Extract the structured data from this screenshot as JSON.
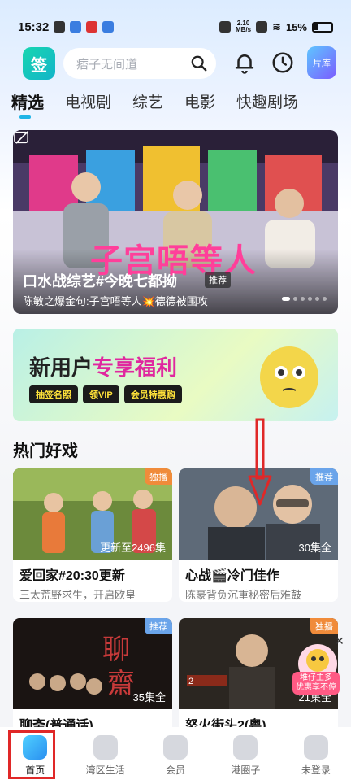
{
  "status": {
    "time": "15:32",
    "speed_value": "2.10",
    "speed_unit": "MB/s",
    "battery": "15%"
  },
  "header": {
    "search_placeholder": "痞子无间道",
    "library_label": "片库"
  },
  "tabs": [
    {
      "label": "精选"
    },
    {
      "label": "电视剧"
    },
    {
      "label": "综艺"
    },
    {
      "label": "电影"
    },
    {
      "label": "快趣剧场"
    }
  ],
  "banner": {
    "title": "口水战综艺#今晚七都拗",
    "badge": "推荐",
    "subtitle": "陈敏之爆金句:子宫唔等人💥德德被围攻",
    "overlay_text": "子宫唔等人"
  },
  "promo": {
    "title_part1": "新用户",
    "title_part2": "专享福利",
    "pills": [
      "抽签名照",
      "领VIP",
      "会员特惠购"
    ]
  },
  "section": {
    "title": "热门好戏"
  },
  "cards": [
    {
      "title": "爱回家#20:30更新",
      "subtitle": "三太荒野求生，开启欧皇",
      "tag": "独播",
      "episodes": "更新至2496集"
    },
    {
      "title": "心战🎬冷门佳作",
      "subtitle": "陈豪背负沉重秘密后难鼓",
      "tag": "推荐",
      "episodes": "30集全"
    },
    {
      "title": "聊斋(普通话)",
      "subtitle": "",
      "tag": "推荐",
      "episodes": "35集全"
    },
    {
      "title": "怒火街头2(粤)",
      "subtitle": "",
      "tag": "独播",
      "episodes": "21集全"
    }
  ],
  "float_ad": {
    "label_line1": "堆仔主多",
    "label_line2": "优惠享不停"
  },
  "nav": [
    {
      "label": "首页"
    },
    {
      "label": "湾区生活"
    },
    {
      "label": "会员"
    },
    {
      "label": "港圈子"
    },
    {
      "label": "未登录"
    }
  ]
}
